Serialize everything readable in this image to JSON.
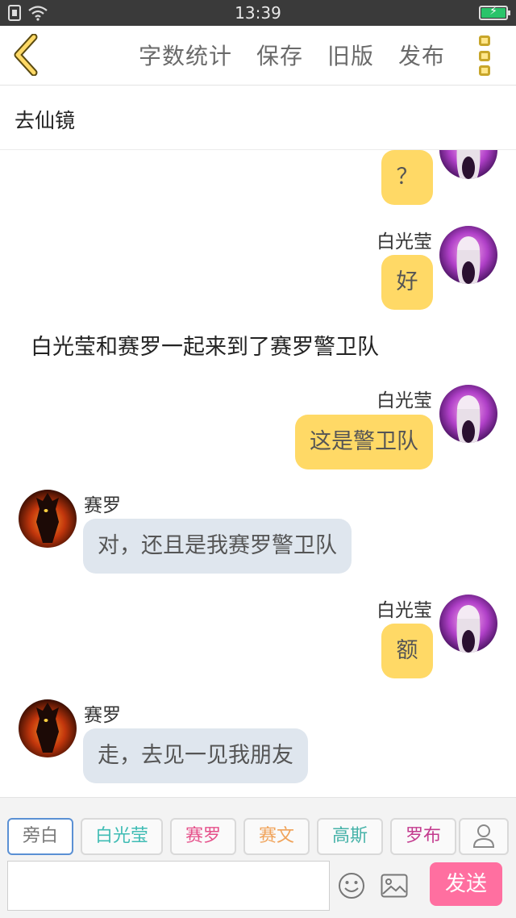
{
  "status_bar": {
    "time": "13:39",
    "battery_level": 1.0
  },
  "toolbar": {
    "links": [
      "字数统计",
      "保存",
      "旧版",
      "发布"
    ]
  },
  "chapter": {
    "title": "去仙镜"
  },
  "messages": [
    {
      "type": "mine",
      "name": "",
      "text": "？"
    },
    {
      "type": "mine",
      "name": "白光莹",
      "text": "好"
    },
    {
      "type": "narration",
      "text": "白光莹和赛罗一起来到了赛罗警卫队"
    },
    {
      "type": "mine",
      "name": "白光莹",
      "text": "这是警卫队"
    },
    {
      "type": "theirs",
      "name": "赛罗",
      "text": "对，还且是我赛罗警卫队"
    },
    {
      "type": "mine",
      "name": "白光莹",
      "text": "额"
    },
    {
      "type": "theirs",
      "name": "赛罗",
      "text": "走，去见一见我朋友"
    }
  ],
  "roles": [
    {
      "label": "旁白",
      "color": "#777777",
      "active": true
    },
    {
      "label": "白光莹",
      "color": "#3fbcb4",
      "active": false
    },
    {
      "label": "赛罗",
      "color": "#e5508a",
      "active": false
    },
    {
      "label": "赛文",
      "color": "#f0a35a",
      "active": false
    },
    {
      "label": "高斯",
      "color": "#45b2a8",
      "active": false
    },
    {
      "label": "罗布",
      "color": "#c33a8e",
      "active": false
    }
  ],
  "composer": {
    "input_value": "",
    "send_label": "发送"
  },
  "colors": {
    "accent_yellow": "#ffd966",
    "bubble_gray": "#dfe6ee",
    "send_pink": "#ff6fa0"
  }
}
